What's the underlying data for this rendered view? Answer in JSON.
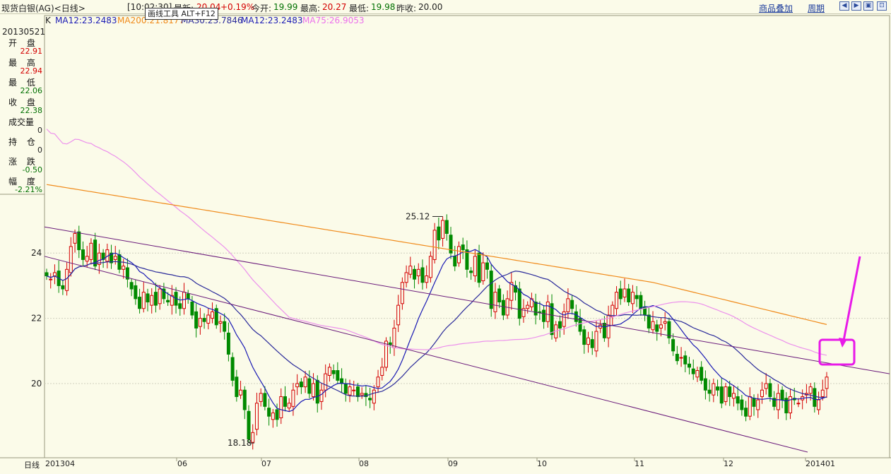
{
  "header": {
    "symbol_label": "现货白银(AG)<日线>",
    "time": "[10:02:30]",
    "latest_label": "最新:",
    "latest_value": "20.04",
    "change_pct": "+0.19%",
    "open_label": "今开:",
    "open_value": "19.99",
    "high_label": "最高:",
    "high_value": "20.27",
    "low_label": "最低:",
    "low_value": "19.98",
    "prev_close_label": "昨收:",
    "prev_close_value": "20.00",
    "tooltip": "画线工具 ALT+F12",
    "overlay_button": "商品叠加",
    "period_button": "周期",
    "nav_icons": [
      "arrow-left-icon",
      "arrow-right-icon",
      "zoom-icon",
      "restore-icon"
    ]
  },
  "ma_legend": {
    "k": "K",
    "ma12": "MA12:23.2483",
    "ma200": "MA200:21.8177",
    "ma30": "MA30:23.7846",
    "ma12b": "MA12:23.2483",
    "ma75": "MA75:26.9053"
  },
  "info_panel": {
    "date": "20130521",
    "open_label": "开 盘",
    "open": "22.91",
    "high_label": "最 高",
    "high": "22.94",
    "low_label": "最 低",
    "low": "22.06",
    "close_label": "收 盘",
    "close": "22.38",
    "volume_label": "成交量",
    "volume": "0",
    "oi_label": "持 仓",
    "oi": "0",
    "change_label": "涨 跌",
    "change": "-0.50",
    "amplitude_label": "幅 度",
    "amplitude": "-2.21%"
  },
  "bottom": {
    "period_label": "日线",
    "x_labels": [
      "201304",
      "06",
      "07",
      "08",
      "09",
      "10",
      "11",
      "12",
      "201401"
    ]
  },
  "colors": {
    "background": "#fbfbe9",
    "up": "#d40000",
    "down": "#008a00",
    "ma12": "#1a1ab4",
    "ma200": "#f08a1a",
    "ma30": "#2a2a9a",
    "ma75": "#ec90ec",
    "trendline": "#6a1a7a",
    "annotation": "#e81ae8"
  },
  "chart_data": {
    "type": "candlestick",
    "title": "现货白银(AG) 日线",
    "ylim": [
      18,
      26
    ],
    "y_ticks": [
      20,
      22,
      24
    ],
    "high_label": "25.12",
    "low_label": "18.18",
    "x_month_labels": [
      "201304",
      "06",
      "07",
      "08",
      "09",
      "10",
      "11",
      "12",
      "201401"
    ],
    "close_series": [
      23.3,
      23.2,
      23.4,
      23.0,
      22.9,
      23.5,
      24.2,
      24.6,
      24.1,
      23.8,
      23.9,
      24.3,
      23.6,
      24.0,
      23.8,
      24.1,
      23.7,
      23.9,
      23.5,
      23.6,
      23.2,
      22.9,
      22.6,
      22.3,
      22.8,
      22.5,
      22.7,
      22.4,
      22.9,
      22.6,
      22.5,
      22.7,
      22.4,
      22.3,
      22.8,
      22.6,
      22.1,
      21.7,
      22.0,
      21.9,
      22.1,
      22.2,
      21.8,
      21.9,
      21.6,
      20.9,
      20.1,
      19.6,
      19.8,
      19.2,
      18.3,
      18.5,
      19.4,
      19.7,
      19.3,
      19.0,
      19.1,
      18.9,
      19.6,
      19.3,
      19.4,
      19.8,
      20.0,
      19.9,
      20.2,
      19.7,
      20.0,
      19.4,
      19.8,
      20.3,
      20.5,
      20.3,
      20.1,
      20.0,
      19.7,
      19.9,
      19.8,
      19.6,
      19.7,
      19.6,
      19.5,
      19.8,
      20.2,
      20.5,
      21.3,
      21.2,
      21.7,
      22.4,
      23.1,
      23.4,
      23.6,
      23.2,
      23.5,
      23.1,
      23.3,
      23.9,
      24.7,
      24.4,
      25.0,
      24.6,
      24.0,
      23.6,
      24.2,
      24.1,
      23.5,
      23.4,
      23.9,
      23.1,
      23.7,
      23.5,
      22.3,
      22.8,
      22.5,
      22.1,
      22.6,
      23.1,
      22.8,
      22.0,
      22.3,
      22.4,
      22.6,
      22.1,
      22.2,
      21.9,
      22.5,
      21.5,
      21.8,
      21.7,
      22.2,
      22.6,
      22.3,
      21.9,
      21.6,
      21.2,
      21.4,
      21.1,
      21.6,
      21.8,
      21.4,
      22.1,
      22.4,
      22.8,
      22.6,
      22.9,
      22.5,
      22.8,
      22.6,
      22.3,
      22.1,
      21.7,
      21.9,
      21.6,
      21.8,
      21.9,
      21.4,
      21.0,
      20.7,
      20.8,
      20.6,
      20.5,
      20.3,
      20.4,
      20.1,
      19.8,
      19.7,
      20.0,
      19.8,
      19.4,
      19.9,
      19.6,
      19.7,
      19.4,
      19.2,
      19.0,
      19.6,
      19.3,
      19.5,
      19.8,
      20.0,
      19.6,
      19.3,
      19.7,
      19.5,
      19.1,
      19.6,
      19.5,
      19.4,
      19.6,
      19.7,
      19.9,
      19.3,
      19.5,
      19.8,
      20.2
    ]
  }
}
